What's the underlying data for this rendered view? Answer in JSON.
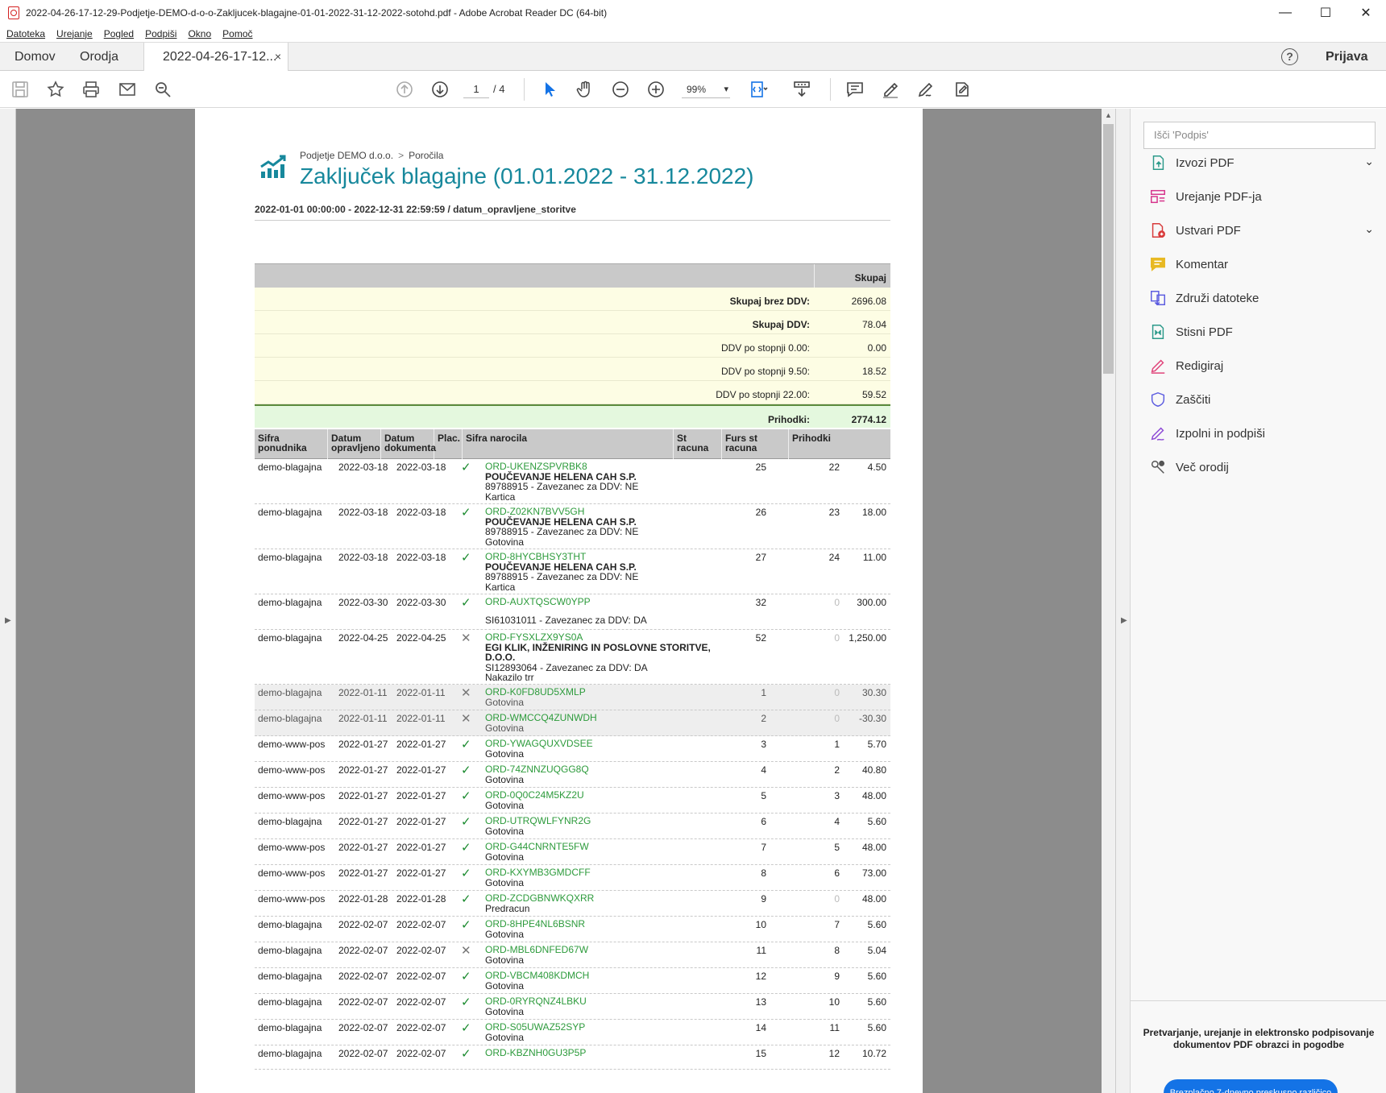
{
  "window": {
    "title": "2022-04-26-17-12-29-Podjetje-DEMO-d-o-o-Zakljucek-blagajne-01-01-2022-31-12-2022-sotohd.pdf - Adobe Acrobat Reader DC (64-bit)",
    "minimize": "—",
    "maximize": "☐",
    "close": "✕"
  },
  "menu": [
    "Datoteka",
    "Urejanje",
    "Pogled",
    "Podpiši",
    "Okno",
    "Pomoč"
  ],
  "tabs": {
    "home": "Domov",
    "tools": "Orodja",
    "document": "2022-04-26-17-12...",
    "close": "×",
    "help": "?",
    "login": "Prijava"
  },
  "toolbar": {
    "page_current": "1",
    "page_total": "/ 4",
    "zoom": "99%"
  },
  "report": {
    "breadcrumb_company": "Podjetje DEMO d.o.o.",
    "breadcrumb_separator": ">",
    "breadcrumb_section": "Poročila",
    "title": "Zaključek blagajne (01.01.2022 - 31.12.2022)",
    "subtitle": "2022-01-01 00:00:00 - 2022-12-31 22:59:59 / datum_opravljene_storitve",
    "summary_header": "Skupaj",
    "summary": [
      {
        "label": "Skupaj brez DDV:",
        "value": "2696.08",
        "bold": true
      },
      {
        "label": "Skupaj DDV:",
        "value": "78.04",
        "bold": true
      },
      {
        "label": "DDV po stopnji 0.00:",
        "value": "0.00",
        "bold": false
      },
      {
        "label": "DDV po stopnji 9.50:",
        "value": "18.52",
        "bold": false
      },
      {
        "label": "DDV po stopnji 22.00:",
        "value": "59.52",
        "bold": false
      }
    ],
    "income_label": "Prihodki:",
    "income_value": "2774.12",
    "columns": {
      "c1": "Sifra ponudnika",
      "c2": "Datum opravljeno",
      "c3": "Datum dokumenta",
      "c4": "Plac.",
      "c5": "Sifra narocila",
      "c6": "St racuna",
      "c7": "Furs st racuna",
      "c8": "Prihodki"
    },
    "rows": [
      {
        "provider": "demo-blagajna",
        "date_done": "2022-03-18",
        "date_doc": "2022-03-18",
        "paid": "✓",
        "order": "ORD-UKENZSPVRBK8",
        "customer": "POUČEVANJE HELENA CAH S.P.",
        "tax": "89788915 - Zavezanec za DDV: NE",
        "method": "Kartica",
        "num": "25",
        "furs": "22",
        "income": "4.50"
      },
      {
        "provider": "demo-blagajna",
        "date_done": "2022-03-18",
        "date_doc": "2022-03-18",
        "paid": "✓",
        "order": "ORD-Z02KN7BVV5GH",
        "customer": "POUČEVANJE HELENA CAH S.P.",
        "tax": "89788915 - Zavezanec za DDV: NE",
        "method": "Gotovina",
        "num": "26",
        "furs": "23",
        "income": "18.00"
      },
      {
        "provider": "demo-blagajna",
        "date_done": "2022-03-18",
        "date_doc": "2022-03-18",
        "paid": "✓",
        "order": "ORD-8HYCBHSY3THT",
        "customer": "POUČEVANJE HELENA CAH S.P.",
        "tax": "89788915 - Zavezanec za DDV: NE",
        "method": "Kartica",
        "num": "27",
        "furs": "24",
        "income": "11.00"
      },
      {
        "provider": "demo-blagajna",
        "date_done": "2022-03-30",
        "date_doc": "2022-03-30",
        "paid": "✓",
        "order": "ORD-AUXTQSCW0YPP",
        "customer": "",
        "tax": "SI61031011 - Zavezanec za DDV: DA",
        "method": "",
        "num": "32",
        "furs": "0",
        "income": "300.00"
      },
      {
        "provider": "demo-blagajna",
        "date_done": "2022-04-25",
        "date_doc": "2022-04-25",
        "paid": "✕",
        "order": "ORD-FYSXLZX9YS0A",
        "customer": "EGI KLIK, INŽENIRING IN POSLOVNE STORITVE, D.O.O.",
        "tax": "SI12893064 - Zavezanec za DDV: DA",
        "method": "Nakazilo trr",
        "num": "52",
        "furs": "0",
        "income": "1,250.00"
      },
      {
        "provider": "demo-blagajna",
        "date_done": "2022-01-11",
        "date_doc": "2022-01-11",
        "paid": "✕",
        "order": "ORD-K0FD8UD5XMLP",
        "customer": "",
        "tax": "",
        "method": "Gotovina",
        "num": "1",
        "furs": "0",
        "income": "30.30",
        "grey": true
      },
      {
        "provider": "demo-blagajna",
        "date_done": "2022-01-11",
        "date_doc": "2022-01-11",
        "paid": "✕",
        "order": "ORD-WMCCQ4ZUNWDH",
        "customer": "",
        "tax": "",
        "method": "Gotovina",
        "num": "2",
        "furs": "0",
        "income": "-30.30",
        "grey": true
      },
      {
        "provider": "demo-www-pos",
        "date_done": "2022-01-27",
        "date_doc": "2022-01-27",
        "paid": "✓",
        "order": "ORD-YWAGQUXVDSEE",
        "customer": "",
        "tax": "",
        "method": "Gotovina",
        "num": "3",
        "furs": "1",
        "income": "5.70"
      },
      {
        "provider": "demo-www-pos",
        "date_done": "2022-01-27",
        "date_doc": "2022-01-27",
        "paid": "✓",
        "order": "ORD-74ZNNZUQGG8Q",
        "customer": "",
        "tax": "",
        "method": "Gotovina",
        "num": "4",
        "furs": "2",
        "income": "40.80"
      },
      {
        "provider": "demo-www-pos",
        "date_done": "2022-01-27",
        "date_doc": "2022-01-27",
        "paid": "✓",
        "order": "ORD-0Q0C24M5KZ2U",
        "customer": "",
        "tax": "",
        "method": "Gotovina",
        "num": "5",
        "furs": "3",
        "income": "48.00"
      },
      {
        "provider": "demo-blagajna",
        "date_done": "2022-01-27",
        "date_doc": "2022-01-27",
        "paid": "✓",
        "order": "ORD-UTRQWLFYNR2G",
        "customer": "",
        "tax": "",
        "method": "Gotovina",
        "num": "6",
        "furs": "4",
        "income": "5.60"
      },
      {
        "provider": "demo-www-pos",
        "date_done": "2022-01-27",
        "date_doc": "2022-01-27",
        "paid": "✓",
        "order": "ORD-G44CNRNTE5FW",
        "customer": "",
        "tax": "",
        "method": "Gotovina",
        "num": "7",
        "furs": "5",
        "income": "48.00"
      },
      {
        "provider": "demo-www-pos",
        "date_done": "2022-01-27",
        "date_doc": "2022-01-27",
        "paid": "✓",
        "order": "ORD-KXYMB3GMDCFF",
        "customer": "",
        "tax": "",
        "method": "Gotovina",
        "num": "8",
        "furs": "6",
        "income": "73.00"
      },
      {
        "provider": "demo-www-pos",
        "date_done": "2022-01-28",
        "date_doc": "2022-01-28",
        "paid": "✓",
        "order": "ORD-ZCDGBNWKQXRR",
        "customer": "",
        "tax": "",
        "method": "Predracun",
        "num": "9",
        "furs": "0",
        "income": "48.00"
      },
      {
        "provider": "demo-blagajna",
        "date_done": "2022-02-07",
        "date_doc": "2022-02-07",
        "paid": "✓",
        "order": "ORD-8HPE4NL6BSNR",
        "customer": "",
        "tax": "",
        "method": "Gotovina",
        "num": "10",
        "furs": "7",
        "income": "5.60"
      },
      {
        "provider": "demo-blagajna",
        "date_done": "2022-02-07",
        "date_doc": "2022-02-07",
        "paid": "✕",
        "order": "ORD-MBL6DNFED67W",
        "customer": "",
        "tax": "",
        "method": "Gotovina",
        "num": "11",
        "furs": "8",
        "income": "5.04"
      },
      {
        "provider": "demo-blagajna",
        "date_done": "2022-02-07",
        "date_doc": "2022-02-07",
        "paid": "✓",
        "order": "ORD-VBCM408KDMCH",
        "customer": "",
        "tax": "",
        "method": "Gotovina",
        "num": "12",
        "furs": "9",
        "income": "5.60"
      },
      {
        "provider": "demo-blagajna",
        "date_done": "2022-02-07",
        "date_doc": "2022-02-07",
        "paid": "✓",
        "order": "ORD-0RYRQNZ4LBKU",
        "customer": "",
        "tax": "",
        "method": "Gotovina",
        "num": "13",
        "furs": "10",
        "income": "5.60"
      },
      {
        "provider": "demo-blagajna",
        "date_done": "2022-02-07",
        "date_doc": "2022-02-07",
        "paid": "✓",
        "order": "ORD-S05UWAZ52SYP",
        "customer": "",
        "tax": "",
        "method": "Gotovina",
        "num": "14",
        "furs": "11",
        "income": "5.60"
      },
      {
        "provider": "demo-blagajna",
        "date_done": "2022-02-07",
        "date_doc": "2022-02-07",
        "paid": "✓",
        "order": "ORD-KBZNH0GU3P5P",
        "customer": "",
        "tax": "",
        "method": "",
        "num": "15",
        "furs": "12",
        "income": "10.72"
      }
    ]
  },
  "right_panel": {
    "search_placeholder": "Išči 'Podpis'",
    "tools": [
      {
        "label": "Izvozi PDF",
        "icon": "export-pdf-icon",
        "color": "#2c9a8a",
        "chevron": true
      },
      {
        "label": "Urejanje PDF-ja",
        "icon": "edit-pdf-icon",
        "color": "#d6348c",
        "chevron": false
      },
      {
        "label": "Ustvari PDF",
        "icon": "create-pdf-icon",
        "color": "#d83b3b",
        "chevron": true
      },
      {
        "label": "Komentar",
        "icon": "comment-icon",
        "color": "#e8b923",
        "chevron": false
      },
      {
        "label": "Združi datoteke",
        "icon": "combine-files-icon",
        "color": "#5c5ce0",
        "chevron": false
      },
      {
        "label": "Stisni PDF",
        "icon": "compress-pdf-icon",
        "color": "#2c9a8a",
        "chevron": false
      },
      {
        "label": "Redigiraj",
        "icon": "redact-icon",
        "color": "#e0457b",
        "chevron": false
      },
      {
        "label": "Zaščiti",
        "icon": "protect-icon",
        "color": "#5c5ce0",
        "chevron": false
      },
      {
        "label": "Izpolni in podpiši",
        "icon": "fill-sign-icon",
        "color": "#8e4bd6",
        "chevron": false
      },
      {
        "label": "Več orodij",
        "icon": "more-tools-icon",
        "color": "#555555",
        "chevron": false
      }
    ],
    "promo_text": "Pretvarjanje, urejanje in elektronsko podpisovanje dokumentov PDF obrazci in pogodbe",
    "promo_button": "Brezplačno 7-dnevno preskusno različico"
  },
  "colors": {
    "title_teal": "#17889c",
    "order_green": "#2d9b3c",
    "summary_yellow": "#fdfde4",
    "income_green": "#e4f8de",
    "promo_blue": "#1473e6"
  }
}
